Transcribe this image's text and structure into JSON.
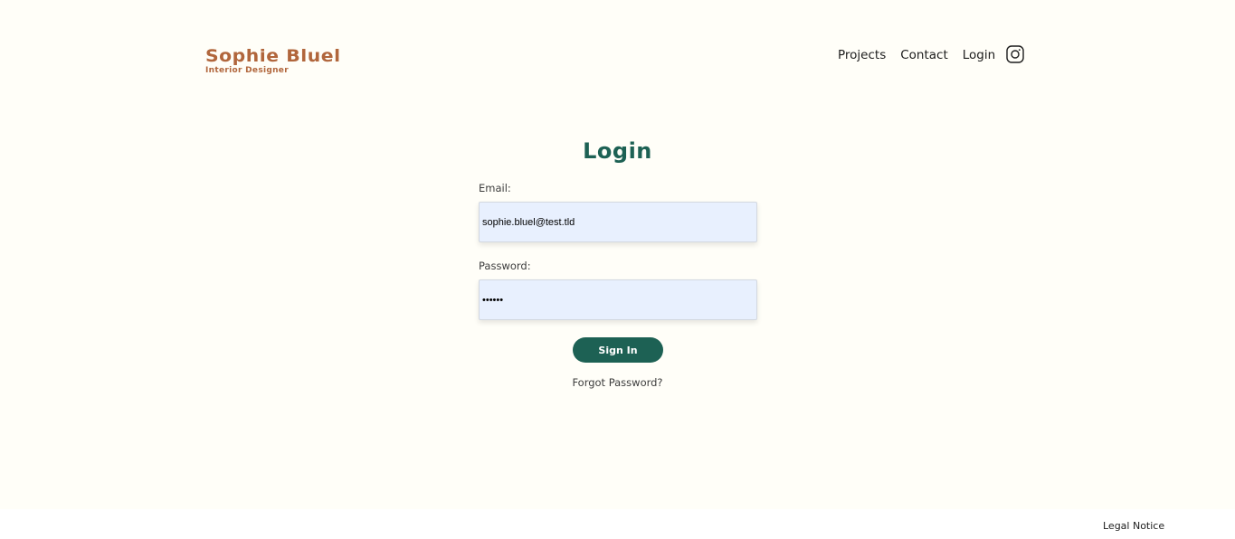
{
  "header": {
    "logo_title": "Sophie Bluel",
    "logo_subtitle": "Interior Designer",
    "nav": {
      "projects": "Projects",
      "contact": "Contact",
      "login": "Login"
    },
    "social_icon": "instagram-icon"
  },
  "login_form": {
    "title": "Login",
    "email_label": "Email:",
    "email_value": "sophie.bluel@test.tld",
    "password_label": "Password:",
    "password_value": "••••••",
    "submit_label": "Sign In",
    "forgot_label": "Forgot Password?"
  },
  "footer": {
    "legal_label": "Legal Notice"
  },
  "colors": {
    "brand": "#b1663c",
    "accent": "#1d6154",
    "background": "#fffef8",
    "input_background": "#e8f0fe"
  }
}
